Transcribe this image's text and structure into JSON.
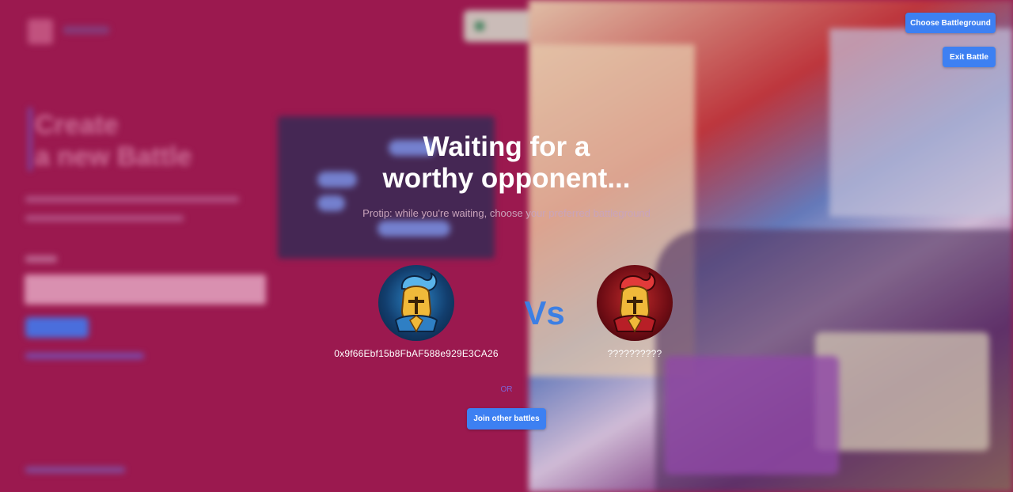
{
  "header": {
    "choose_battleground": "Choose Battleground",
    "exit_battle": "Exit Battle"
  },
  "background": {
    "title": "Create a new Battle",
    "title_line1": "Create",
    "title_line2": "a new Battle"
  },
  "waiting": {
    "headline_line1": "Waiting for a",
    "headline_line2": "worthy opponent...",
    "protip": "Protip: while you're waiting, choose your preferred battleground"
  },
  "players": {
    "player_one": {
      "name": "0x9f66Ebf15b8FbAF588e929E3CA26",
      "avatar": "blue-knight-icon"
    },
    "versus": "Vs",
    "player_two": {
      "name": "??????????",
      "avatar": "red-knight-icon"
    }
  },
  "actions": {
    "or": "OR",
    "join_other_battles": "Join other battles"
  },
  "colors": {
    "background": "#9b1a4f",
    "button": "#3d80f2",
    "vs": "#3c7fe4",
    "or": "#7d66d8"
  }
}
